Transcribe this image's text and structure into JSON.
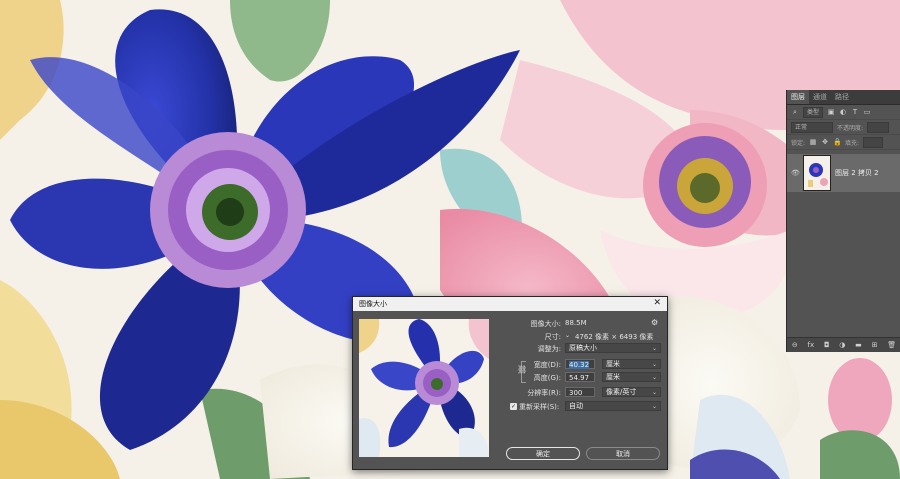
{
  "layers_panel": {
    "tabs": [
      "图层",
      "通道",
      "路径"
    ],
    "kind_filter": "类型",
    "blend_mode": "正常",
    "opacity_label": "不透明度:",
    "lock_label": "锁定:",
    "fill_label": "填充:",
    "layer_name": "图层 2 拷贝 2"
  },
  "dialog": {
    "title": "图像大小",
    "image_size_label": "图像大小:",
    "image_size_value": "88.5M",
    "dimensions_label": "尺寸:",
    "dimensions_value": "4762 像素 × 6493 像素",
    "fit_to_label": "调整为:",
    "fit_to_value": "原稿大小",
    "width_label": "宽度(D):",
    "width_value": "40.32",
    "width_unit": "厘米",
    "height_label": "高度(G):",
    "height_value": "54.97",
    "height_unit": "厘米",
    "resolution_label": "分辨率(R):",
    "resolution_value": "300",
    "resolution_unit": "像素/英寸",
    "resample_label": "重新采样(S):",
    "resample_checked": true,
    "resample_value": "自动",
    "ok_label": "确定",
    "cancel_label": "取消"
  }
}
